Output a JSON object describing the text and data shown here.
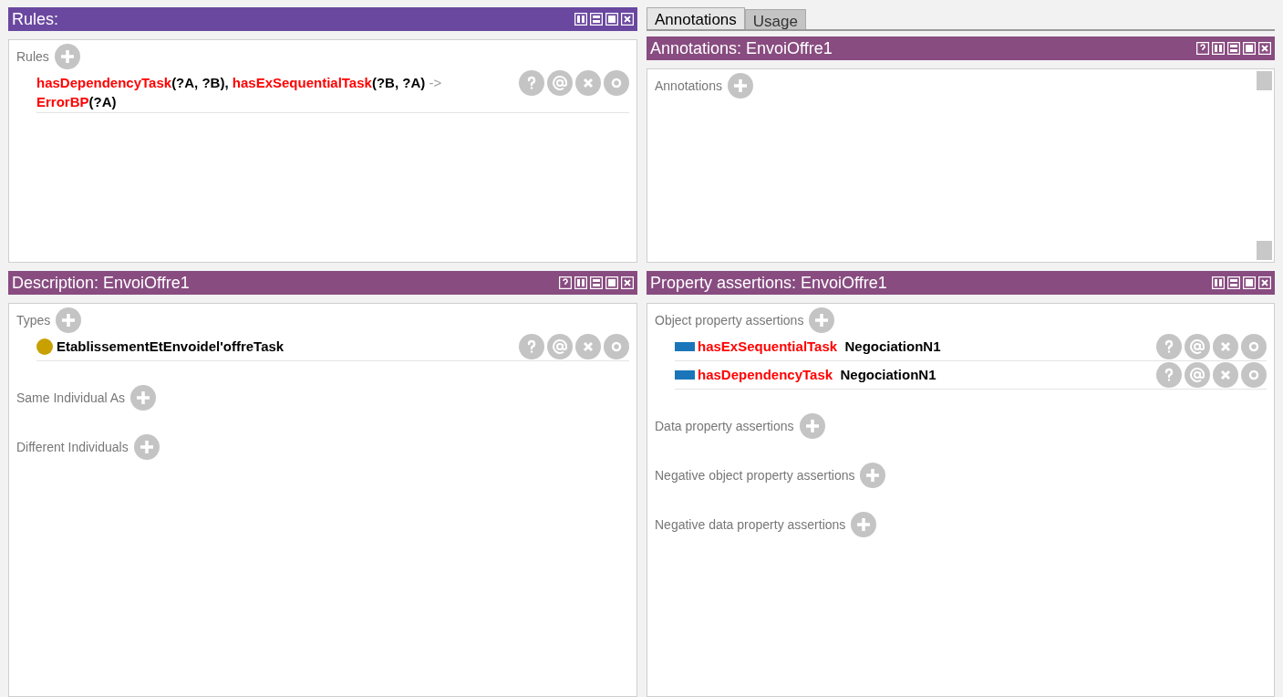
{
  "rules_panel": {
    "title": "Rules:",
    "has_help": false,
    "sections": [
      {
        "label": "Rules",
        "items": [
          {
            "kind": "rule",
            "segments": [
              {
                "kind": "entity",
                "text": "hasDependencyTask"
              },
              {
                "kind": "plain",
                "text": "(?A, ?B), "
              },
              {
                "kind": "entity",
                "text": "hasExSequentialTask"
              },
              {
                "kind": "plain",
                "text": "(?B, ?A) "
              },
              {
                "kind": "arrow",
                "text": "->"
              },
              {
                "kind": "entity",
                "text": "ErrorBP"
              },
              {
                "kind": "plain",
                "text": "(?A)"
              }
            ]
          }
        ]
      }
    ]
  },
  "tabs": [
    {
      "label": "Annotations",
      "selected": true
    },
    {
      "label": "Usage",
      "selected": false
    }
  ],
  "annotations_panel": {
    "title": "Annotations: EnvoiOffre1",
    "has_help": true,
    "sections": [
      {
        "label": "Annotations"
      }
    ]
  },
  "description_panel": {
    "title": "Description: EnvoiOffre1",
    "has_help": true,
    "sections": [
      {
        "label": "Types",
        "items": [
          {
            "kind": "class",
            "segments": [
              {
                "kind": "plain",
                "text": "EtablissementEtEnvoidel'offreTask"
              }
            ]
          }
        ]
      },
      {
        "label": "Same Individual As"
      },
      {
        "label": "Different Individuals"
      }
    ]
  },
  "property_panel": {
    "title": "Property assertions: EnvoiOffre1",
    "has_help": false,
    "sections": [
      {
        "label": "Object property assertions",
        "items": [
          {
            "kind": "object_property",
            "segments": [
              {
                "kind": "entity",
                "text": "hasExSequentialTask"
              },
              {
                "kind": "plain",
                "text": "  NegociationN1"
              }
            ]
          },
          {
            "kind": "object_property",
            "segments": [
              {
                "kind": "entity",
                "text": "hasDependencyTask"
              },
              {
                "kind": "plain",
                "text": "  NegociationN1"
              }
            ]
          }
        ]
      },
      {
        "label": "Data property assertions"
      },
      {
        "label": "Negative object property assertions"
      },
      {
        "label": "Negative data property assertions"
      }
    ]
  }
}
